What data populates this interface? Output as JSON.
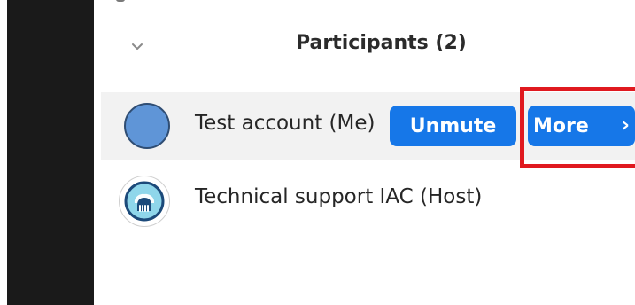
{
  "panel": {
    "title": "Participants (2)"
  },
  "participants": [
    {
      "name": "Test account (Me)",
      "actions": {
        "unmute_label": "Unmute",
        "more_label": "More",
        "more_chevron": "›"
      }
    },
    {
      "name": "Technical support IAC (Host)"
    }
  ],
  "icons": {
    "collapse": "chevron-down-icon",
    "host_avatar": "host-avatar-icon"
  },
  "colors": {
    "button_blue": "#1677e8",
    "highlight_red": "#e0191f",
    "row_highlight": "#f2f2f2",
    "dark_bar": "#1a1a1a"
  }
}
